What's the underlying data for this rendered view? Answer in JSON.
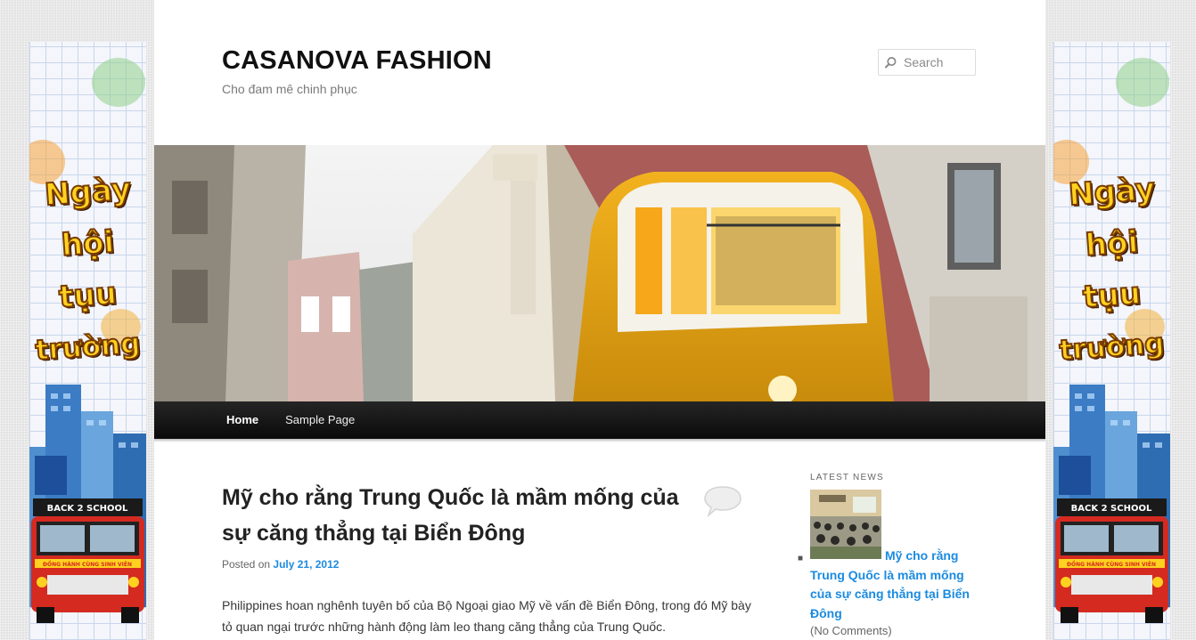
{
  "site": {
    "title": "CASANOVA FASHION",
    "description": "Cho đam mê chinh phục"
  },
  "search": {
    "placeholder": "Search",
    "icon": "search-icon"
  },
  "nav": {
    "items": [
      {
        "label": "Home",
        "current": true
      },
      {
        "label": "Sample Page",
        "current": false
      }
    ]
  },
  "post": {
    "title": "Mỹ cho rằng Trung Quốc là mầm mống của sự căng thẳng tại Biển Đông",
    "posted_prefix": "Posted on",
    "date": "July 21, 2012",
    "excerpt": "Philippines hoan nghênh tuyên bố của Bộ Ngoại giao Mỹ về vấn đề Biển Đông, trong đó Mỹ bày tỏ quan ngại trước những hành động làm leo thang căng thẳng của Trung Quốc."
  },
  "sidebar": {
    "widget_title": "LATEST NEWS",
    "news": [
      {
        "title": "Mỹ cho rằng Trung Quốc là mầm mống của sự căng thẳng tại Biển Đông",
        "meta": "(No Comments)"
      }
    ]
  },
  "banner": {
    "words": [
      "Ngày",
      "hội",
      "tụu",
      "trường"
    ],
    "sign": "BACK 2 SCHOOL",
    "bus_slogan": "ĐỒNG HÀNH CÙNG SINH VIÊN"
  },
  "colors": {
    "link": "#1b8be0",
    "nav_bg": "#111111",
    "banner_text": "#ffd21f",
    "bus_red": "#d42a20"
  }
}
